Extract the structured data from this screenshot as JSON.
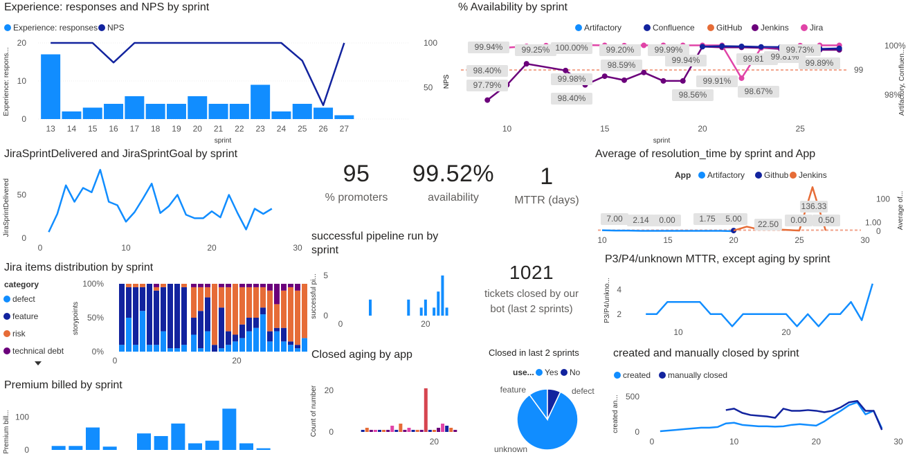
{
  "colors": {
    "blue": "#118DFF",
    "navy": "#12239E",
    "orange": "#E66C37",
    "purple": "#6B007B",
    "pink": "#E044A7",
    "grey": "#605e5c",
    "red": "#D64550"
  },
  "kpis": [
    {
      "value": "95",
      "label": "% promoters"
    },
    {
      "value": "99.52%",
      "label": "availability"
    },
    {
      "value": "1",
      "label": "MTTR (days)"
    },
    {
      "value": "1021",
      "label": "tickets closed by our bot (last 2 sprints)"
    }
  ],
  "panels": {
    "exp": {
      "title": "Experience: responses and NPS by sprint",
      "xlabel": "sprint",
      "ylabel_left": "Experience: respons...",
      "ylabel_right": "NPS",
      "legend": [
        "Experience: responses",
        "NPS"
      ]
    },
    "avail": {
      "title": "% Availability by sprint",
      "xlabel": "sprint",
      "ylabel_right": "Artifactory, Confluen...",
      "legend": [
        "Artifactory",
        "Confluence",
        "GitHub",
        "Jenkins",
        "Jira"
      ],
      "ref_label": "99"
    },
    "jira_sprint": {
      "title": "JiraSprintDelivered and JiraSprintGoal by sprint",
      "ylabel": "JiraSprintDelivered"
    },
    "resolution": {
      "title": "Average of resolution_time by sprint and App",
      "legend_title": "App",
      "legend": [
        "Artifactory",
        "Github",
        "Jenkins"
      ],
      "ylabel_right": "Average of...",
      "ref_label": "1.00"
    },
    "jira_items": {
      "title": "Jira items distribution by sprint",
      "legend_title": "category",
      "legend": [
        "defect",
        "feature",
        "risk",
        "technical debt"
      ],
      "ylabel": "storypoints"
    },
    "pipeline": {
      "title": "successful pipeline run by sprint",
      "ylabel": "successful pi..."
    },
    "p3": {
      "title": "P3/P4/unknown MTTR, except aging by sprint",
      "ylabel": "P3/P4/unkno..."
    },
    "premium": {
      "title": "Premium billed by sprint",
      "ylabel": "Premium bill..."
    },
    "aging": {
      "title": "Closed aging by app",
      "ylabel": "Count of number"
    },
    "closed2": {
      "title": "Closed in last 2 sprints",
      "legend_title": "use...",
      "legend": [
        "Yes",
        "No"
      ],
      "slice_labels": [
        "feature",
        "defect",
        "unknown"
      ]
    },
    "created": {
      "title": "created and manually closed by sprint",
      "legend": [
        "created",
        "manually closed"
      ],
      "ylabel": "created an..."
    }
  },
  "chart_data": [
    {
      "id": "exp",
      "type": "bar",
      "categories": [
        "13",
        "14",
        "15",
        "16",
        "17",
        "18",
        "19",
        "20",
        "21",
        "22",
        "23",
        "24",
        "25",
        "26",
        "27"
      ],
      "series": [
        {
          "name": "Experience: responses",
          "values": [
            17,
            2,
            3,
            4,
            6,
            4,
            4,
            6,
            4,
            4,
            9,
            2,
            4,
            3,
            1
          ]
        },
        {
          "name": "NPS",
          "type": "line",
          "values": [
            100,
            100,
            100,
            78,
            100,
            100,
            100,
            100,
            100,
            100,
            100,
            100,
            80,
            30,
            100
          ]
        }
      ],
      "xlabel": "sprint",
      "ylim": [
        0,
        20
      ],
      "yticks": [
        0,
        10,
        20
      ],
      "y2lim": [
        30,
        100
      ],
      "y2ticks": [
        50,
        100
      ]
    },
    {
      "id": "avail",
      "type": "line",
      "xlim": [
        8,
        28
      ],
      "xticks": [
        10,
        15,
        20,
        25
      ],
      "ylim": [
        97.5,
        100.2
      ],
      "series": [
        {
          "name": "Jenkins",
          "x": [
            9,
            10,
            11,
            13,
            14,
            15,
            16,
            17,
            18,
            19,
            20,
            21,
            22,
            23,
            24,
            25,
            26,
            27
          ],
          "values": [
            97.79,
            98.4,
            99.25,
            98.98,
            98.4,
            98.75,
            98.59,
            98.9,
            98.56,
            98.56,
            99.94,
            99.91,
            99.91,
            99.89,
            99.85,
            99.81,
            99.81,
            99.81
          ]
        },
        {
          "name": "Jira",
          "x": [
            9,
            10,
            11,
            12,
            13,
            14,
            15,
            16,
            17,
            18,
            19,
            20,
            21,
            22,
            23,
            24,
            25,
            26,
            27
          ],
          "values": [
            99.94,
            99.9,
            99.95,
            99.98,
            99.99,
            100.0,
            99.99,
            99.98,
            99.99,
            99.99,
            99.99,
            99.99,
            99.99,
            98.67,
            99.89,
            99.91,
            99.98,
            99.99,
            99.99
          ]
        },
        {
          "name": "Confluence",
          "x": [
            20,
            21,
            22,
            23,
            24,
            25,
            26,
            27
          ],
          "values": [
            99.94,
            99.96,
            99.95,
            99.93,
            99.92,
            99.89,
            99.85,
            99.87
          ]
        }
      ],
      "data_labels": [
        "99.94%",
        "99.25%",
        "100.00%",
        "99.20%",
        "99.99%",
        "98.40%",
        "99.98%",
        "98.59%",
        "99.94%",
        "99.91%",
        "99.81%",
        "99.81%",
        "99.89%",
        "97.79%",
        "98.40%",
        "98.56%",
        "98.67%",
        "99.73%"
      ],
      "yticks_right": [
        "100%",
        "98%"
      ],
      "ylabel_left": "NPS",
      "ref": 99
    },
    {
      "id": "jira_sprint",
      "type": "line",
      "xlim": [
        0,
        30
      ],
      "xticks": [
        0,
        10,
        20,
        30
      ],
      "ylim": [
        0,
        80
      ],
      "yticks": [
        0,
        50
      ],
      "series": [
        {
          "name": "JiraSprintDelivered",
          "x": [
            1,
            2,
            3,
            4,
            5,
            6,
            7,
            8,
            9,
            10,
            11,
            12,
            13,
            14,
            15,
            16,
            17,
            18,
            19,
            20,
            21,
            22,
            23,
            24,
            25,
            26,
            27
          ],
          "values": [
            7,
            28,
            61,
            42,
            58,
            53,
            79,
            42,
            38,
            19,
            30,
            46,
            63,
            29,
            37,
            50,
            27,
            23,
            23,
            31,
            24,
            50,
            29,
            10,
            34,
            28,
            34
          ]
        }
      ]
    },
    {
      "id": "resolution",
      "type": "line",
      "xlim": [
        10,
        30
      ],
      "xticks": [
        10,
        15,
        20,
        25,
        30
      ],
      "ylim": [
        0,
        150
      ],
      "yticks": [
        0,
        100
      ],
      "series": [
        {
          "name": "Artifactory",
          "x": [
            10,
            11,
            12,
            13,
            14,
            15,
            16,
            17,
            18,
            19,
            20
          ],
          "values": [
            3,
            2,
            2,
            1,
            1,
            1,
            1,
            1,
            1,
            1,
            0
          ]
        },
        {
          "name": "Github",
          "x": [
            20
          ],
          "values": [
            2
          ]
        },
        {
          "name": "Jenkins",
          "x": [
            20,
            21,
            22,
            23,
            24,
            25,
            26,
            27
          ],
          "values": [
            2,
            14,
            5,
            6,
            4,
            2,
            136.33,
            2
          ]
        }
      ],
      "data_labels": [
        "7.00",
        "2.14",
        "0.00",
        "1.75",
        "5.00",
        "22.50",
        "136.33",
        "0.00",
        "0.50"
      ],
      "ref": 1
    },
    {
      "id": "jira_items",
      "type": "bar",
      "stacked": "100%",
      "xticks": [
        0,
        20
      ],
      "yticks": [
        "0%",
        "50%",
        "100%"
      ],
      "series": [
        {
          "name": "defect"
        },
        {
          "name": "feature"
        },
        {
          "name": "risk"
        },
        {
          "name": "technical debt"
        }
      ],
      "shares": [
        [
          0.1,
          0.9,
          0,
          0
        ],
        [
          0.5,
          0.45,
          0.05,
          0
        ],
        [
          0.1,
          0.85,
          0.05,
          0
        ],
        [
          0.6,
          0.35,
          0.05,
          0
        ],
        [
          0.1,
          0.9,
          0,
          0
        ],
        [
          0.1,
          0.8,
          0.05,
          0.05
        ],
        [
          0.3,
          0.65,
          0.05,
          0
        ],
        [
          0.05,
          0.95,
          0,
          0
        ],
        [
          0.05,
          0.95,
          0,
          0
        ],
        [
          0.1,
          0.85,
          0.05,
          0
        ],
        [
          0.25,
          0.25,
          0.45,
          0.05
        ],
        [
          0.05,
          0.55,
          0.35,
          0.05
        ],
        [
          0.3,
          0.5,
          0.15,
          0.05
        ],
        [
          0,
          0.1,
          0.9,
          0
        ],
        [
          0.05,
          0.6,
          0.3,
          0.05
        ],
        [
          0.1,
          0.2,
          0.65,
          0.05
        ],
        [
          0.15,
          0.1,
          0.75,
          0
        ],
        [
          0.2,
          0.2,
          0.55,
          0.05
        ],
        [
          0.3,
          0.2,
          0.45,
          0.05
        ],
        [
          0.35,
          0.15,
          0.45,
          0.05
        ],
        [
          0.55,
          0.1,
          0.3,
          0.05
        ],
        [
          0.15,
          0.15,
          0.6,
          0.1
        ],
        [
          0.3,
          0.05,
          0.35,
          0.3
        ],
        [
          0.15,
          0.2,
          0.55,
          0.1
        ],
        [
          0.1,
          0.05,
          0.8,
          0.05
        ],
        [
          0.05,
          0.05,
          0.8,
          0.1
        ],
        [
          0.2,
          0,
          0.8,
          0
        ]
      ]
    },
    {
      "id": "pipeline",
      "type": "bar",
      "xlim": [
        0,
        28
      ],
      "xticks": [
        0,
        20
      ],
      "ylim": [
        0,
        5
      ],
      "yticks": [
        0,
        5
      ],
      "x": [
        7,
        16,
        19,
        20,
        22,
        23,
        24,
        25
      ],
      "values": [
        2,
        2,
        1,
        2,
        1,
        3,
        5,
        1
      ]
    },
    {
      "id": "p3",
      "type": "line",
      "xlim": [
        5,
        30
      ],
      "xticks": [
        10,
        20
      ],
      "ylim": [
        0,
        5
      ],
      "yticks": [
        2,
        4
      ],
      "series": [
        {
          "name": "MTTR",
          "x": [
            7,
            8,
            9,
            10,
            11,
            12,
            13,
            14,
            15,
            16,
            17,
            18,
            19,
            20,
            21,
            22,
            23,
            24,
            25,
            26,
            27,
            28
          ],
          "values": [
            2,
            2,
            3,
            3,
            3,
            3,
            2,
            2,
            1,
            2,
            2,
            2,
            2,
            2,
            1,
            2,
            1,
            2,
            2,
            3,
            1.5,
            4.5
          ]
        }
      ]
    },
    {
      "id": "premium",
      "type": "bar",
      "xlim": [
        0,
        30
      ],
      "ylim": [
        0,
        130
      ],
      "yticks": [
        0,
        100
      ],
      "x": [
        2,
        4,
        6,
        8,
        10,
        12,
        14,
        16,
        18,
        20,
        22,
        24,
        26,
        28
      ],
      "values": [
        12,
        12,
        68,
        10,
        0,
        50,
        42,
        80,
        20,
        28,
        125,
        20,
        5,
        0
      ]
    },
    {
      "id": "aging",
      "type": "bar",
      "stacked": true,
      "xlim": [
        0,
        28
      ],
      "xticks": [
        20
      ],
      "ylim": [
        0,
        22
      ],
      "yticks": [
        0,
        20
      ],
      "x": [
        3,
        4,
        5,
        6,
        7,
        8,
        9,
        10,
        11,
        12,
        13,
        14,
        15,
        16,
        17,
        18,
        19,
        20,
        21,
        22,
        23,
        24,
        25
      ],
      "values": [
        1,
        2,
        1,
        1,
        1,
        1,
        1,
        3,
        1,
        4,
        1,
        2,
        1,
        1,
        1,
        21,
        1,
        1,
        2,
        4,
        3,
        2,
        1
      ]
    },
    {
      "id": "closed2",
      "type": "pie",
      "slices": [
        {
          "label": "unknown",
          "value": 83
        },
        {
          "label": "defect",
          "value": 10
        },
        {
          "label": "feature",
          "value": 7
        }
      ]
    },
    {
      "id": "created",
      "type": "line",
      "xlim": [
        0,
        30
      ],
      "xticks": [
        0,
        10,
        20,
        30
      ],
      "ylim": [
        0,
        550
      ],
      "yticks": [
        0,
        500
      ],
      "series": [
        {
          "name": "created",
          "x": [
            1,
            2,
            3,
            4,
            5,
            6,
            7,
            8,
            9,
            10,
            11,
            12,
            13,
            14,
            15,
            16,
            17,
            18,
            19,
            20,
            21,
            22,
            23,
            24,
            25,
            26,
            27,
            28
          ],
          "values": [
            10,
            20,
            30,
            40,
            50,
            60,
            60,
            70,
            120,
            130,
            100,
            90,
            80,
            80,
            75,
            80,
            100,
            110,
            100,
            90,
            150,
            230,
            300,
            380,
            420,
            250,
            300,
            50
          ]
        },
        {
          "name": "manually closed",
          "x": [
            9,
            10,
            11,
            12,
            13,
            14,
            15,
            16,
            17,
            18,
            19,
            20,
            21,
            22,
            23,
            24,
            25,
            26,
            27,
            28
          ],
          "values": [
            310,
            330,
            270,
            240,
            230,
            220,
            200,
            330,
            300,
            300,
            310,
            300,
            280,
            300,
            350,
            420,
            440,
            300,
            300,
            30
          ]
        }
      ]
    }
  ]
}
